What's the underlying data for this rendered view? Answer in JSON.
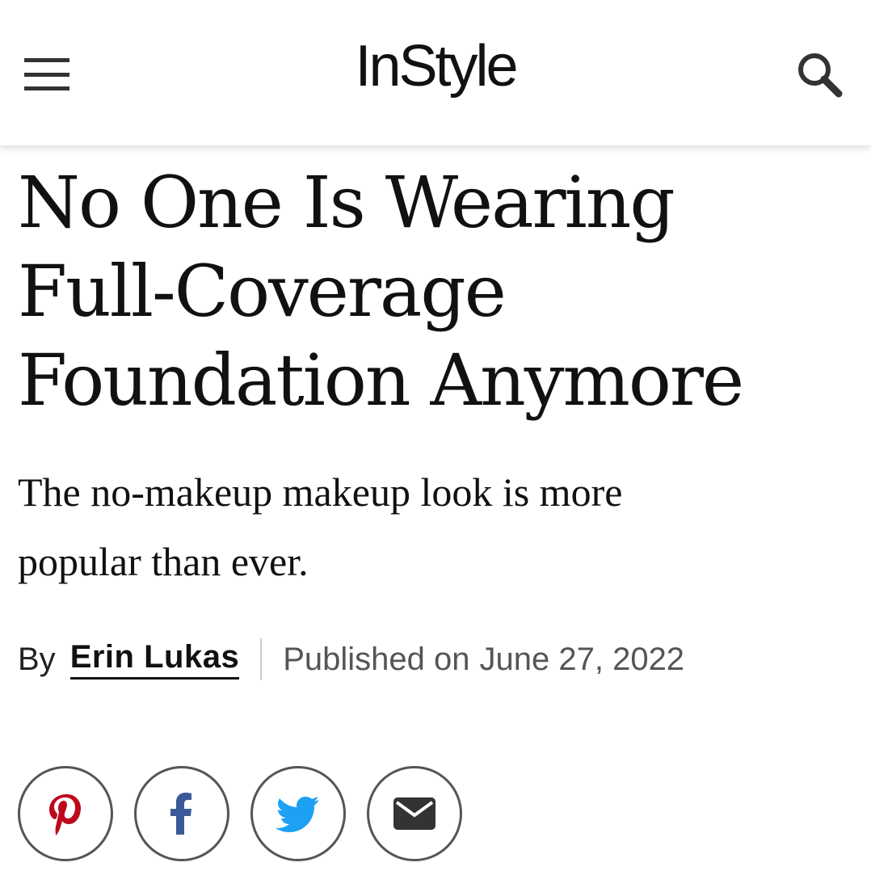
{
  "header": {
    "logo_text": "InStyle",
    "menu_icon": "hamburger-menu-icon",
    "search_icon": "search-icon"
  },
  "article": {
    "headline_lines": [
      "No One Is Wearing",
      "Full-Coverage",
      "Foundation Anymore"
    ],
    "dek_lines": [
      "The no-makeup makeup look is more",
      "popular than ever."
    ],
    "byline": {
      "by_label": "By",
      "author": "Erin Lukas",
      "published_label": "Published on",
      "published_date": "June 27, 2022"
    }
  },
  "share": {
    "buttons": [
      {
        "icon": "pinterest-icon",
        "color": "#BD081C"
      },
      {
        "icon": "facebook-icon",
        "color": "#3B5998"
      },
      {
        "icon": "twitter-icon",
        "color": "#1DA1F2"
      },
      {
        "icon": "email-icon",
        "color": "#333333"
      }
    ]
  }
}
